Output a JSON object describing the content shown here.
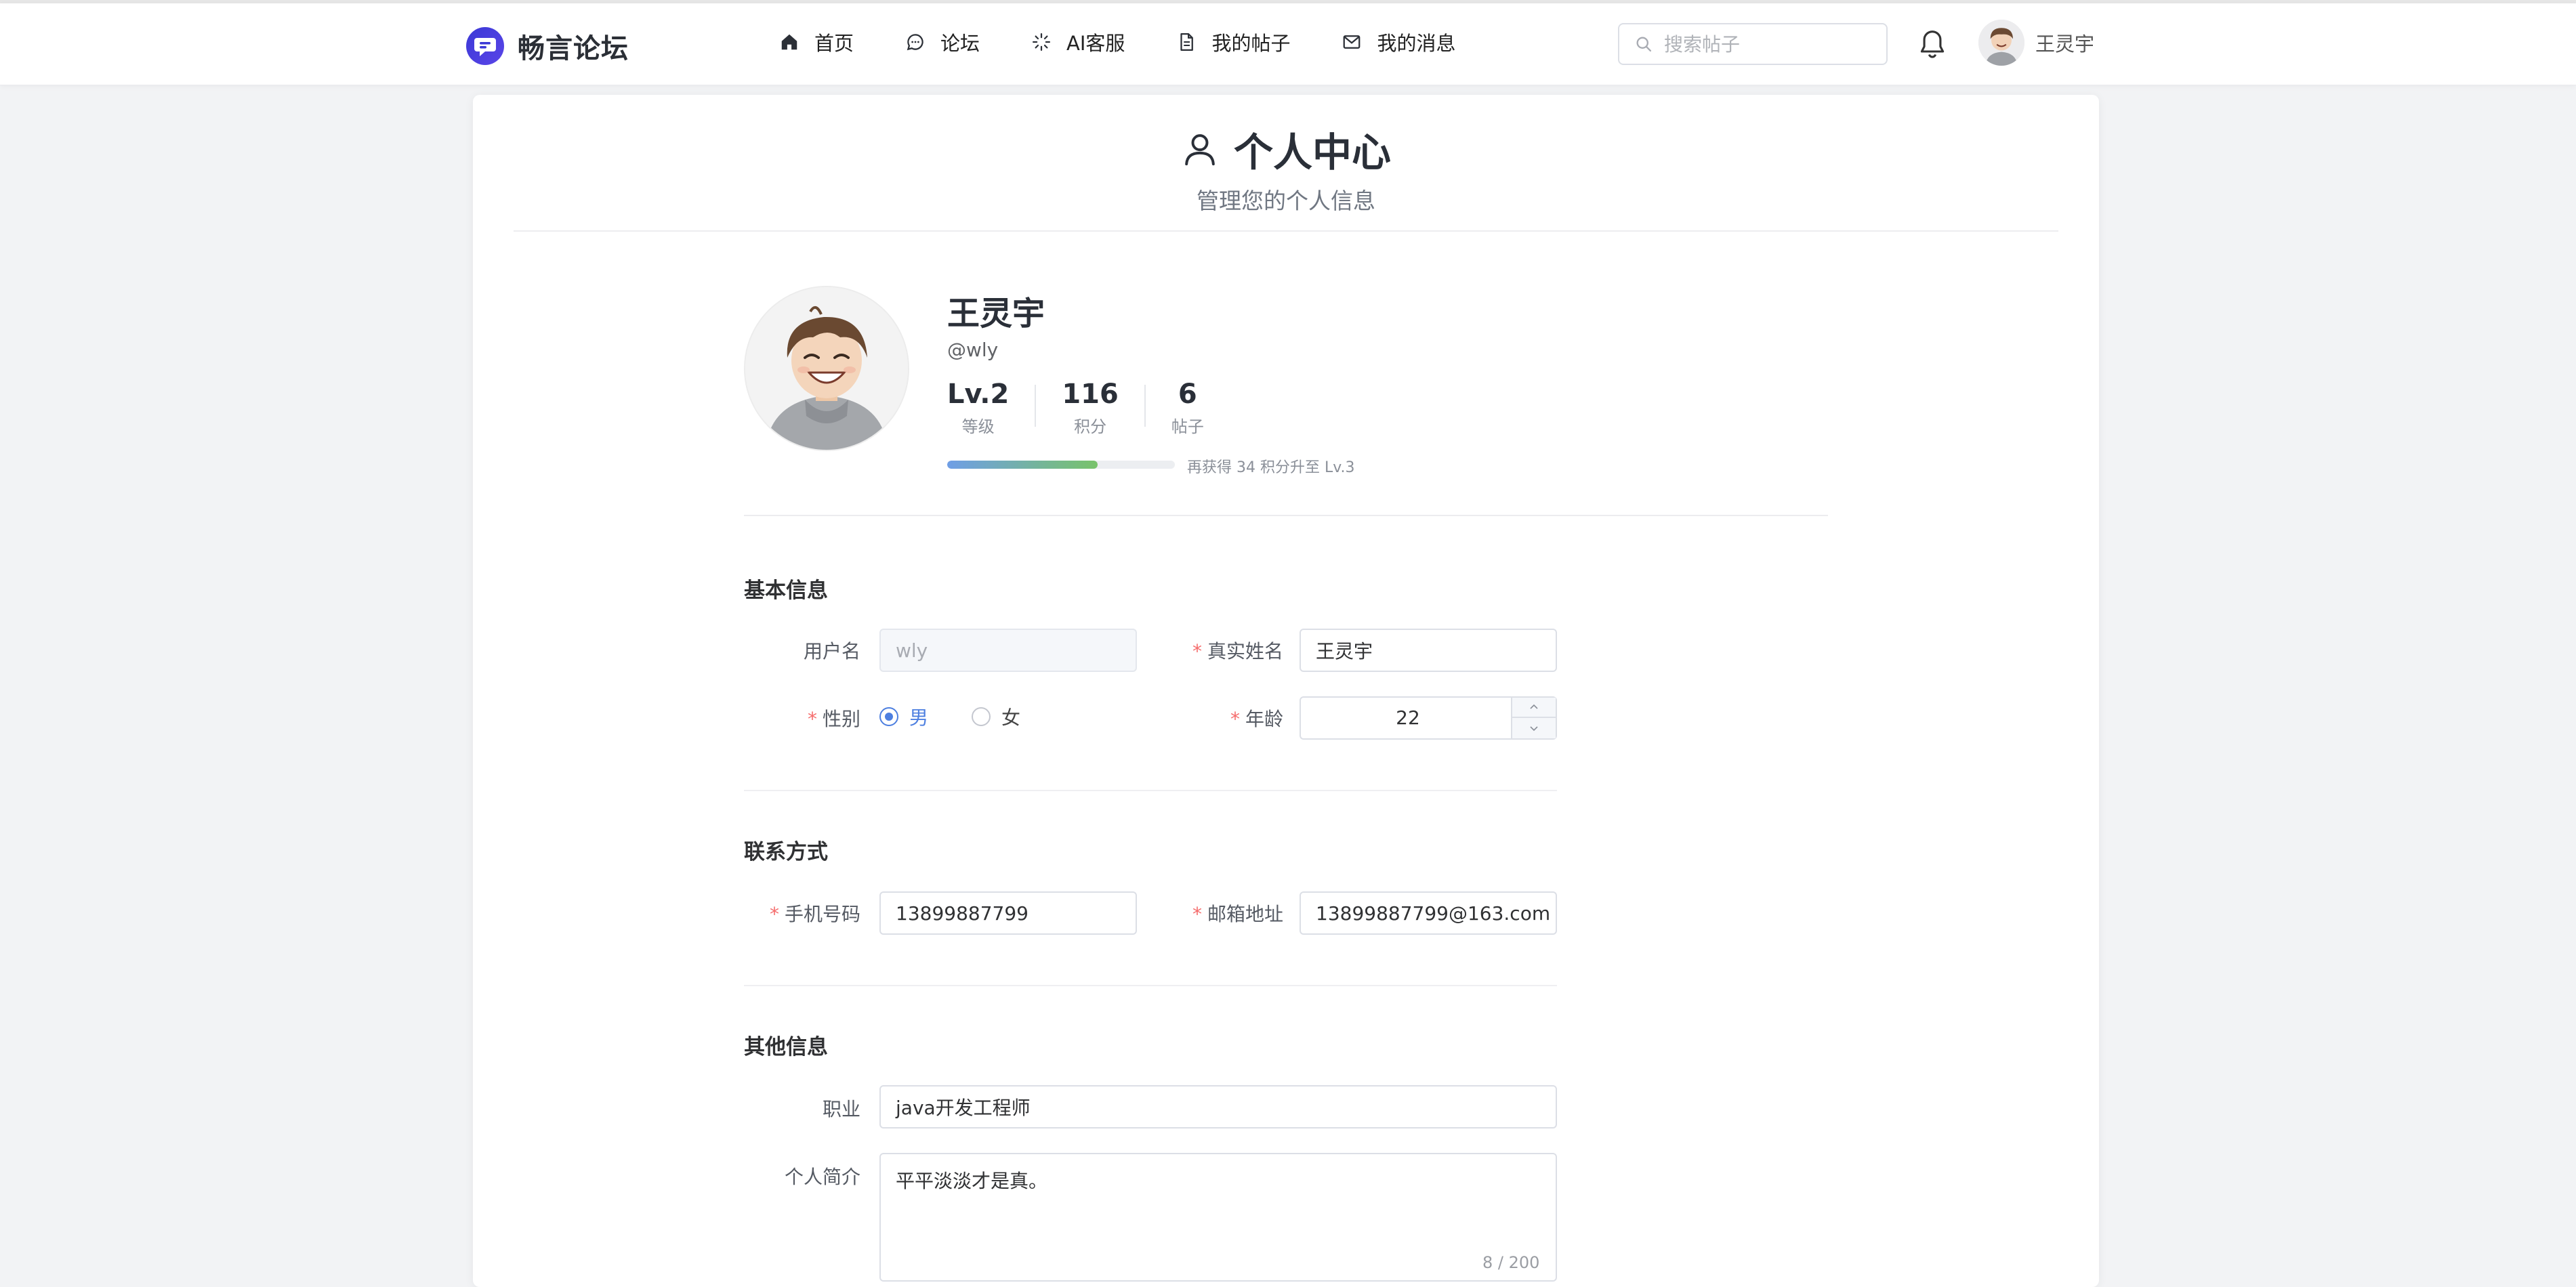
{
  "brand": {
    "name": "畅言论坛"
  },
  "nav": {
    "items": [
      {
        "label": "首页",
        "icon": "home-icon"
      },
      {
        "label": "论坛",
        "icon": "chat-icon"
      },
      {
        "label": "AI客服",
        "icon": "sparkle-icon"
      },
      {
        "label": "我的帖子",
        "icon": "document-icon"
      },
      {
        "label": "我的消息",
        "icon": "mail-icon"
      }
    ]
  },
  "search": {
    "placeholder": "搜索帖子",
    "value": ""
  },
  "header_user": {
    "name": "王灵宇"
  },
  "page": {
    "title": "个人中心",
    "subtitle": "管理您的个人信息"
  },
  "profile": {
    "name": "王灵宇",
    "handle": "@wly",
    "stats": [
      {
        "value": "Lv.2",
        "label": "等级"
      },
      {
        "value": "116",
        "label": "积分"
      },
      {
        "value": "6",
        "label": "帖子"
      }
    ],
    "progress_fraction": 0.66,
    "progress_text": "再获得 34 积分升至 Lv.3"
  },
  "sections": {
    "basic": {
      "title": "基本信息",
      "username_label": "用户名",
      "username_value": "wly",
      "realname_label": "真实姓名",
      "realname_value": "王灵宇",
      "gender_label": "性别",
      "gender_options": [
        "男",
        "女"
      ],
      "gender_selected": "男",
      "age_label": "年龄",
      "age_value": "22"
    },
    "contact": {
      "title": "联系方式",
      "phone_label": "手机号码",
      "phone_value": "13899887799",
      "email_label": "邮箱地址",
      "email_value": "13899887799@163.com"
    },
    "other": {
      "title": "其他信息",
      "job_label": "职业",
      "job_value": "java开发工程师",
      "bio_label": "个人简介",
      "bio_value": "平平淡淡才是真。",
      "bio_counter": "8 / 200"
    }
  },
  "colors": {
    "accent": "#4d7fe0",
    "required": "#f56c6c",
    "progress_start": "#6f9ee6",
    "progress_end": "#78c36a",
    "logo": "#3b39d6"
  }
}
